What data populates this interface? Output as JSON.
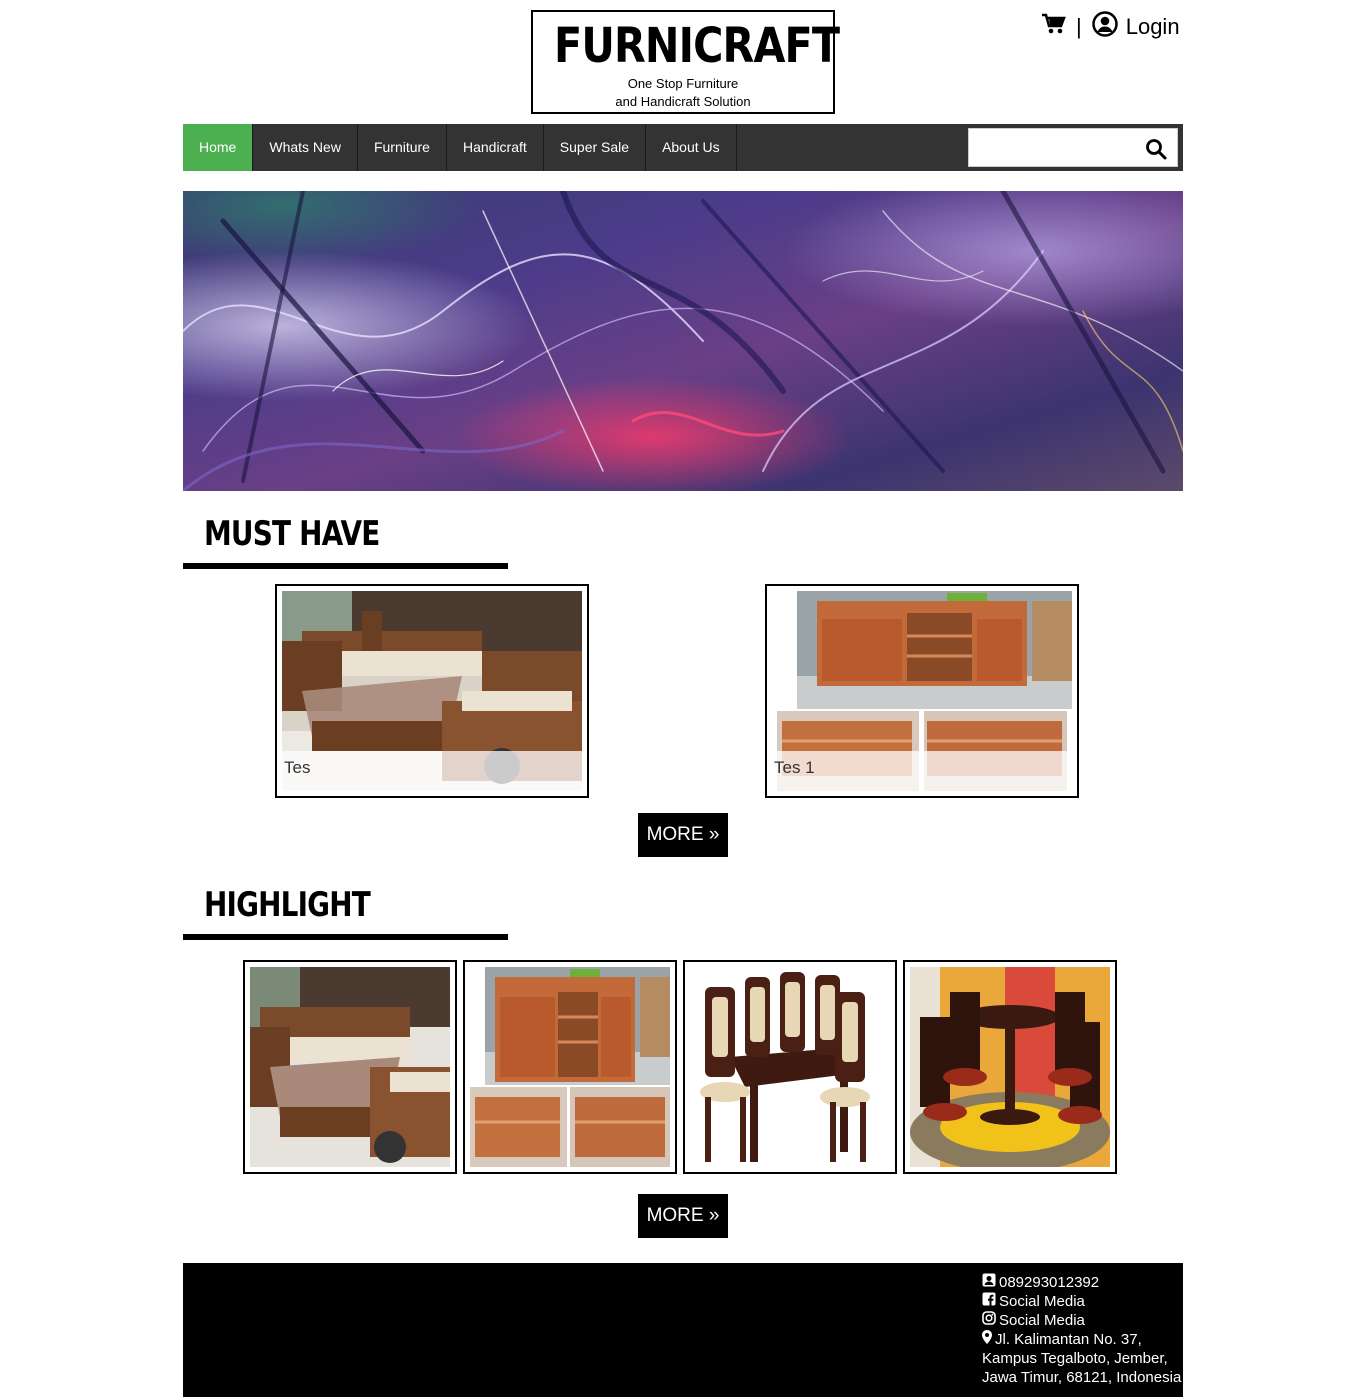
{
  "header": {
    "logo_title": "FURNICRAFT",
    "logo_sub_1": "One Stop Furniture",
    "logo_sub_2": "and Handicraft Solution",
    "separator": "|",
    "login_label": "Login"
  },
  "nav": {
    "items": [
      {
        "label": "Home",
        "active": true
      },
      {
        "label": "Whats New"
      },
      {
        "label": "Furniture"
      },
      {
        "label": "Handicraft"
      },
      {
        "label": "Super Sale"
      },
      {
        "label": "About Us"
      }
    ],
    "search_placeholder": ""
  },
  "must_have": {
    "title": "MUST HAVE",
    "cards": [
      {
        "caption": "Tes",
        "image": "wooden-sofa-set-photo"
      },
      {
        "caption": "Tes 1",
        "image": "wooden-cabinet-photo"
      }
    ],
    "more_label": "MORE »"
  },
  "highlight": {
    "title": "HIGHLIGHT",
    "images": [
      "wooden-sofa-set-photo",
      "wooden-cabinet-photo",
      "dining-set-photo",
      "round-dining-set-photo"
    ],
    "more_label": "MORE »"
  },
  "footer": {
    "phone": "089293012392",
    "facebook": "Social Media",
    "instagram": "Social Media",
    "address_1": "Jl. Kalimantan No. 37,",
    "address_2": "Kampus Tegalboto, Jember,",
    "address_3": "Jawa Timur, 68121, Indonesia"
  },
  "colors": {
    "nav_bg": "#333333",
    "nav_active": "#4caf50",
    "footer_bg": "#000000"
  }
}
